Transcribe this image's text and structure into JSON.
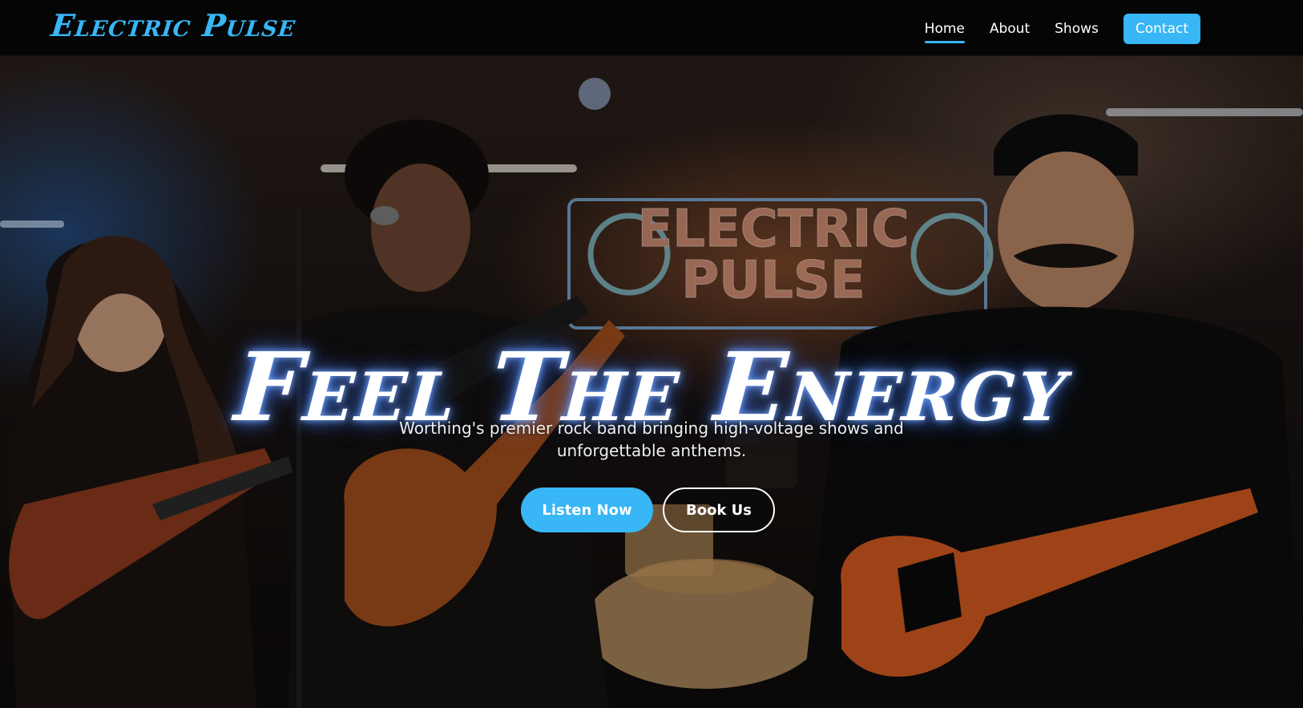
{
  "brand": {
    "logo_text": "Electric Pulse",
    "accent_color": "#38b6f5"
  },
  "nav": {
    "items": [
      {
        "label": "Home",
        "active": true
      },
      {
        "label": "About",
        "active": false
      },
      {
        "label": "Shows",
        "active": false
      }
    ],
    "contact_label": "Contact"
  },
  "hero": {
    "title": "Feel The Energy",
    "subtitle": "Worthing's premier rock band bringing high-voltage shows and unforgettable anthems.",
    "primary_button": "Listen Now",
    "secondary_button": "Book Us",
    "image_sign_text": [
      "ELECTRIC",
      "PULSE"
    ],
    "image_alt": "band performing on stage"
  }
}
